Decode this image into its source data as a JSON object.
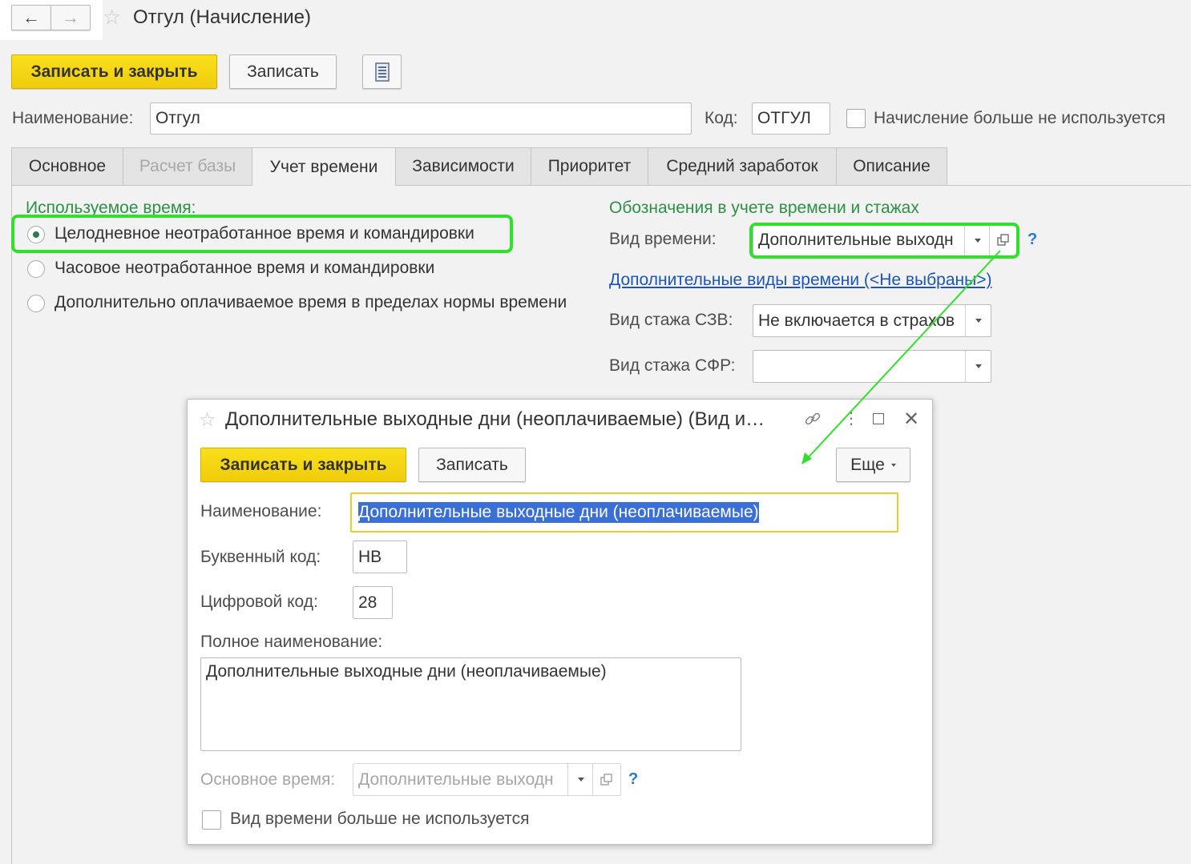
{
  "header": {
    "title": "Отгул (Начисление)"
  },
  "toolbar": {
    "save_close": "Записать и закрыть",
    "save": "Записать"
  },
  "form": {
    "name_label": "Наименование:",
    "name_value": "Отгул",
    "code_label": "Код:",
    "code_value": "ОТГУЛ",
    "unused_label": "Начисление больше не используется"
  },
  "tabs": [
    {
      "label": "Основное"
    },
    {
      "label": "Расчет базы"
    },
    {
      "label": "Учет времени"
    },
    {
      "label": "Зависимости"
    },
    {
      "label": "Приоритет"
    },
    {
      "label": "Средний заработок"
    },
    {
      "label": "Описание"
    }
  ],
  "time_section": {
    "heading": "Используемое время:",
    "options": [
      "Целодневное неотработанное время и командировки",
      "Часовое неотработанное время и командировки",
      "Дополнительно оплачиваемое время в пределах нормы времени"
    ],
    "selected_index": 0
  },
  "designations": {
    "heading": "Обозначения в учете времени и стажах",
    "time_kind_label": "Вид времени:",
    "time_kind_value": "Дополнительные выходн",
    "extra_link": "Дополнительные виды времени (<Не выбраны>)",
    "szv_label": "Вид стажа СЗВ:",
    "szv_value": "Не включается в страхов",
    "sfr_label": "Вид стажа СФР:",
    "sfr_value": "",
    "help": "?"
  },
  "dialog": {
    "title": "Дополнительные выходные дни (неоплачиваемые) (Вид и…",
    "save_close": "Записать и закрыть",
    "save": "Записать",
    "more": "Еще",
    "name_label": "Наименование:",
    "name_value": "Дополнительные выходные дни (неоплачиваемые)",
    "letter_code_label": "Буквенный код:",
    "letter_code_value": "НВ",
    "digit_code_label": "Цифровой код:",
    "digit_code_value": "28",
    "full_name_label": "Полное наименование:",
    "full_name_value": "Дополнительные выходные дни (неоплачиваемые)",
    "base_time_label": "Основное время:",
    "base_time_value": "Дополнительные выходн",
    "unused_label": "Вид времени больше не используется",
    "help": "?"
  },
  "colors": {
    "primary_button": "#f0cd0c",
    "highlight": "#31e02b",
    "green_heading": "#2d9145",
    "link": "#1a56b8",
    "selection": "#3a6fd6"
  }
}
